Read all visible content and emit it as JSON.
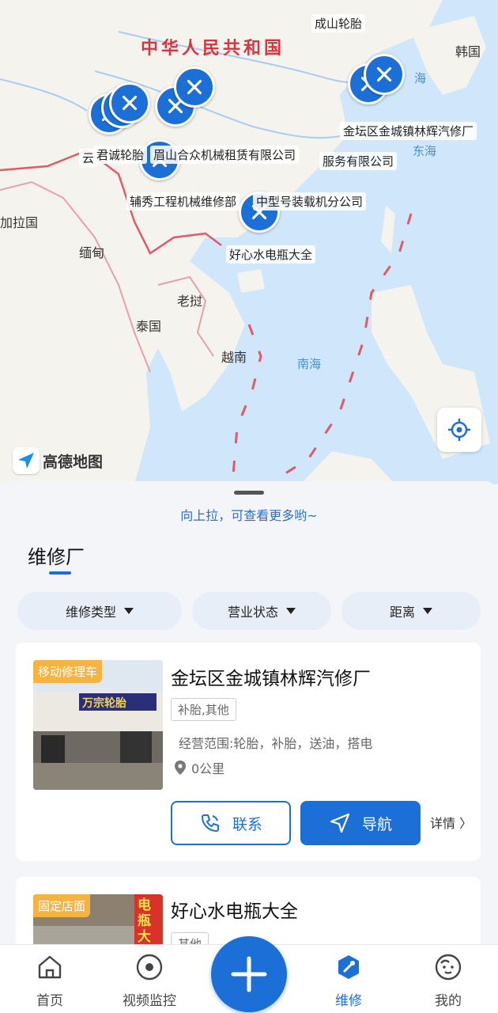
{
  "colors": {
    "accent": "#1c6fd6",
    "tag_orange": "#f5b441",
    "border_red": "#d9343f",
    "sea": "#cfe6fb",
    "land": "#f4f3ee"
  },
  "map": {
    "country_labels": {
      "china": "中华人民共和国",
      "korea": "韩国",
      "laos": "老挝",
      "thailand": "泰国",
      "vietnam": "越南",
      "myanmar": "缅甸",
      "bangladesh": "加拉国"
    },
    "sea_labels": {
      "east_sea": "东海",
      "south_sea": "南海",
      "yellow_sea": "海"
    },
    "poi_labels": {
      "chengshan": "成山轮胎",
      "jintan": "金坛区金城镇林辉汽修厂",
      "yun": "云",
      "junchen": "君诚轮胎",
      "meishan": "眉山合众机械租赁有限公司",
      "fuwu": "服务有限公司",
      "fuxiu": "辅秀工程机械维修部",
      "zhongxing": "中型号装载机分公司",
      "haoxin": "好心水电瓶大全"
    },
    "logo_text": "高德地图",
    "pin_icon": "wrench-screwdriver-icon",
    "locate_icon": "locate-icon"
  },
  "sheet": {
    "pull_hint": "向上拉，可查看更多哟~",
    "section_title": "维修厂",
    "filters": [
      {
        "label": "维修类型"
      },
      {
        "label": "营业状态"
      },
      {
        "label": "距离"
      }
    ]
  },
  "shops": [
    {
      "tag": "移动修理车",
      "sign_text": "万宗轮胎",
      "name": "金坛区金城镇林辉汽修厂",
      "category": "补胎,其他",
      "scope": "经营范围:轮胎，补胎，送油，搭电",
      "distance": "0公里",
      "contact_label": "联系",
      "nav_label": "导航",
      "detail_label": "详情 〉"
    },
    {
      "tag": "固定店面",
      "sign_text": "电瓶大",
      "name": "好心水电瓶大全",
      "category": "其他"
    }
  ],
  "tabbar": {
    "tabs": [
      {
        "label": "首页",
        "icon": "home-icon"
      },
      {
        "label": "视频监控",
        "icon": "video-monitor-icon"
      },
      {
        "label": "维修",
        "icon": "repair-icon"
      },
      {
        "label": "我的",
        "icon": "profile-icon"
      }
    ],
    "fab_icon": "plus-icon"
  }
}
